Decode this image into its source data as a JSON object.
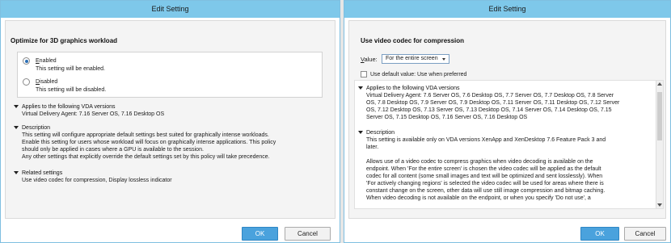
{
  "left_dialog": {
    "title": "Edit Setting",
    "heading": "Optimize for 3D graphics workload",
    "options": [
      {
        "label_prefix": "E",
        "label_rest": "nabled",
        "description": "This setting will be enabled.",
        "selected": true
      },
      {
        "label_prefix": "D",
        "label_rest": "isabled",
        "description": "This setting will be disabled.",
        "selected": false
      }
    ],
    "sections": [
      {
        "title": "Applies to the following VDA versions",
        "lines": [
          "Virtual Delivery Agent: 7.16 Server OS, 7.16 Desktop OS"
        ]
      },
      {
        "title": "Description",
        "lines": [
          "This setting will configure appropriate default settings best suited for graphically intense workloads.",
          "Enable this setting for users whose workload will focus on graphically intense applications. This policy",
          "should only be applied in cases where a GPU is available to the session.",
          "Any other settings that explicitly override the default settings set by this policy will take precedence."
        ]
      },
      {
        "title": "Related settings",
        "lines": [
          "Use video codec for compression, Display lossless indicator"
        ]
      }
    ],
    "ok_label": "OK",
    "cancel_label": "Cancel"
  },
  "right_dialog": {
    "title": "Edit Setting",
    "heading": "Use video codec for compression",
    "value_label_prefix": "V",
    "value_label_rest": "alue:",
    "value_selected": "For the entire screen",
    "use_default_label": "Use default value: Use when preferred",
    "sections": [
      {
        "title": "Applies to the following VDA versions",
        "lines": [
          "Virtual Delivery Agent: 7.6 Server OS, 7.6 Desktop OS, 7.7 Server OS, 7.7 Desktop OS, 7.8 Server",
          "OS, 7.8 Desktop OS, 7.9 Server OS, 7.9 Desktop OS, 7.11 Server OS, 7.11 Desktop OS, 7.12 Server",
          "OS, 7.12 Desktop OS, 7.13 Server OS, 7.13 Desktop OS, 7.14 Server OS, 7.14 Desktop OS, 7.15",
          "Server OS, 7.15 Desktop OS, 7.16 Server OS, 7.16 Desktop OS"
        ]
      },
      {
        "title": "Description",
        "lines": [
          "This setting is available only on VDA versions XenApp and XenDesktop 7.6 Feature Pack 3 and",
          "later.",
          "",
          "Allows use of a video codec to compress graphics when video decoding is available on the",
          "endpoint. When 'For the entire screen' is chosen the video codec will be applied as the default",
          "codec for all content (some small images and text will be optimized and sent losslessly). When",
          "'For actively changing regions' is selected the video codec will be used for areas where there is",
          "constant change on the screen, other data will use still image compression and bitmap caching.",
          "When video decoding is not available on the endpoint, or when you specify 'Do not use', a"
        ]
      }
    ],
    "ok_label": "OK",
    "cancel_label": "Cancel"
  },
  "colors": {
    "titlebar": "#7ec8ea",
    "ok_button": "#4aa2dd",
    "radio_selected": "#2b6fb5"
  }
}
